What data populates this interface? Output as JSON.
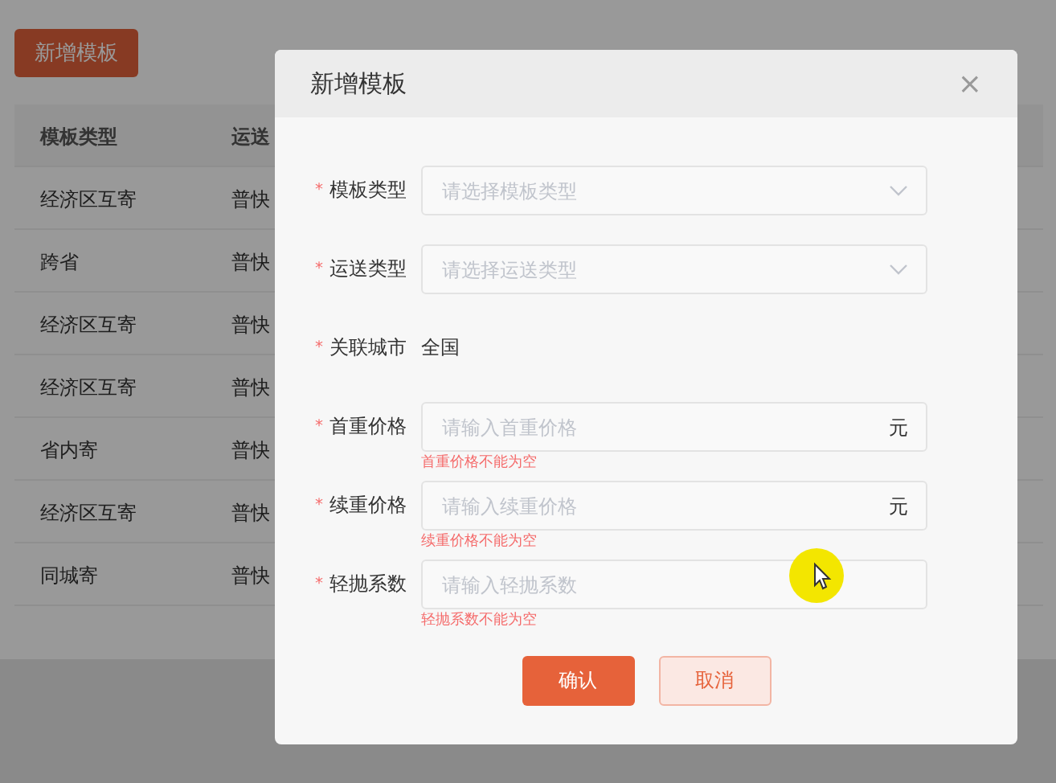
{
  "page": {
    "add_button": "新增模板",
    "table": {
      "columns": [
        "模板类型",
        "运送"
      ],
      "rows": [
        [
          "经济区互寄",
          "普快"
        ],
        [
          "跨省",
          "普快"
        ],
        [
          "经济区互寄",
          "普快"
        ],
        [
          "经济区互寄",
          "普快"
        ],
        [
          "省内寄",
          "普快"
        ],
        [
          "经济区互寄",
          "普快"
        ],
        [
          "同城寄",
          "普快"
        ]
      ]
    }
  },
  "dialog": {
    "title": "新增模板",
    "close": "×",
    "fields": [
      {
        "kind": "select",
        "label": "模板类型",
        "mark": "*",
        "placeholder": "请选择模板类型"
      },
      {
        "kind": "select",
        "label": "运送类型",
        "mark": "*",
        "placeholder": "请选择运送类型"
      },
      {
        "kind": "text",
        "label": "关联城市",
        "mark": "*",
        "value": "全国"
      },
      {
        "kind": "input",
        "label": "首重价格",
        "mark": "*",
        "placeholder": "请输入首重价格",
        "suffix": "元",
        "error": "首重价格不能为空"
      },
      {
        "kind": "input",
        "label": "续重价格",
        "mark": "*",
        "placeholder": "请输入续重价格",
        "suffix": "元",
        "error": "续重价格不能为空"
      },
      {
        "kind": "input",
        "label": "轻抛系数",
        "mark": "*",
        "placeholder": "请输入轻抛系数",
        "error": "轻抛系数不能为空"
      }
    ],
    "buttons": [
      {
        "label": "确认",
        "kind": "primary"
      },
      {
        "label": "取消",
        "kind": "secondary"
      }
    ]
  }
}
